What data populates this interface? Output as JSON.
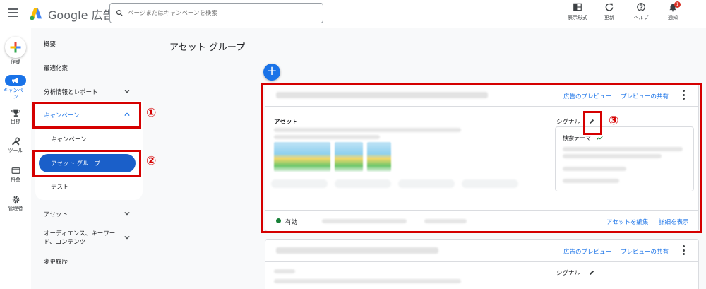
{
  "app": {
    "logo_text": "Google 広告"
  },
  "search": {
    "placeholder": "ページまたはキャンペーンを検索"
  },
  "top_actions": [
    {
      "label": "表示形式",
      "icon": "table-chart-icon"
    },
    {
      "label": "更新",
      "icon": "refresh-icon"
    },
    {
      "label": "ヘルプ",
      "icon": "help-icon"
    },
    {
      "label": "通知",
      "icon": "bell-icon",
      "badge": "1"
    }
  ],
  "rail": [
    {
      "label": "作成",
      "icon": "plus-icon"
    },
    {
      "label": "キャンペーン",
      "icon": "megaphone-icon"
    },
    {
      "label": "目標",
      "icon": "trophy-icon"
    },
    {
      "label": "ツール",
      "icon": "tools-icon"
    },
    {
      "label": "料金",
      "icon": "credit-card-icon"
    },
    {
      "label": "管理者",
      "icon": "gear-icon"
    }
  ],
  "nav": {
    "overview": "概要",
    "optimization": "最適化案",
    "insights": "分析情報とレポート",
    "campaigns_group": "キャンペーン",
    "sub_campaigns": "キャンペーン",
    "sub_asset_groups": "アセット グループ",
    "sub_tests": "テスト",
    "assets": "アセット",
    "audiences_line1": "オーディエンス、キーワー",
    "audiences_line2": "ド、コンテンツ",
    "change_history": "変更履歴"
  },
  "annotations": {
    "n1": "①",
    "n2": "②",
    "n3": "③"
  },
  "main": {
    "page_title": "アセット グループ",
    "add_button": "+",
    "cards": [
      {
        "preview_link": "広告のプレビュー",
        "share_link": "プレビューの共有",
        "assets_label": "アセット",
        "signal_label": "シグナル",
        "search_theme_label": "検索テーマ",
        "status": "有効",
        "edit_assets": "アセットを編集",
        "show_details": "詳細を表示"
      },
      {
        "preview_link": "広告のプレビュー",
        "share_link": "プレビューの共有",
        "assets_label": "アセット",
        "signal_label": "シグナル"
      }
    ]
  },
  "colors": {
    "accent": "#1a73e8",
    "annotation_red": "#d50000",
    "active_pill": "#1a5fc9"
  }
}
